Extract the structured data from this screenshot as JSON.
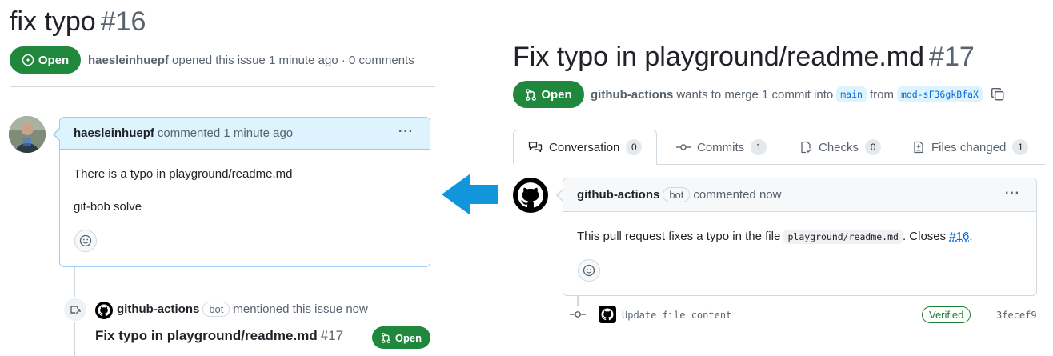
{
  "issue": {
    "title": "fix typo",
    "number": "#16",
    "state": "Open",
    "author": "haesleinhuepf",
    "opened_text": "opened this issue 1 minute ago · 0 comments"
  },
  "issue_comment": {
    "author": "haesleinhuepf",
    "timestamp": "commented 1 minute ago",
    "lines": [
      "There is a typo in playground/readme.md",
      "git-bob solve"
    ]
  },
  "cross_reference": {
    "actor": "github-actions",
    "bot_label": "bot",
    "action": "mentioned this issue now",
    "pr_title": "Fix typo in playground/readme.md",
    "pr_number": "#17",
    "pr_state": "Open"
  },
  "pr": {
    "title": "Fix typo in playground/readme.md",
    "number": "#17",
    "state": "Open",
    "author": "github-actions",
    "merge_text": "wants to merge 1 commit into",
    "base_branch": "main",
    "from_text": "from",
    "head_branch": "mod-sF36gkBfaX"
  },
  "tabs": [
    {
      "label": "Conversation",
      "count": "0",
      "icon": "comment-discussion-icon",
      "active": true
    },
    {
      "label": "Commits",
      "count": "1",
      "icon": "git-commit-icon",
      "active": false
    },
    {
      "label": "Checks",
      "count": "0",
      "icon": "checklist-icon",
      "active": false
    },
    {
      "label": "Files changed",
      "count": "1",
      "icon": "diff-icon",
      "active": false
    }
  ],
  "pr_comment": {
    "author": "github-actions",
    "bot_label": "bot",
    "timestamp": "commented now",
    "text_before": "This pull request fixes a typo in the file",
    "code": "playground/readme.md",
    "text_mid": ". Closes",
    "issue_link": "#16",
    "text_after": "."
  },
  "commit": {
    "message": "Update file content",
    "verified": "Verified",
    "sha": "3fecef9"
  },
  "colors": {
    "open_green": "#1f883d",
    "link_blue": "#0969da",
    "arrow_blue": "#1296db"
  }
}
